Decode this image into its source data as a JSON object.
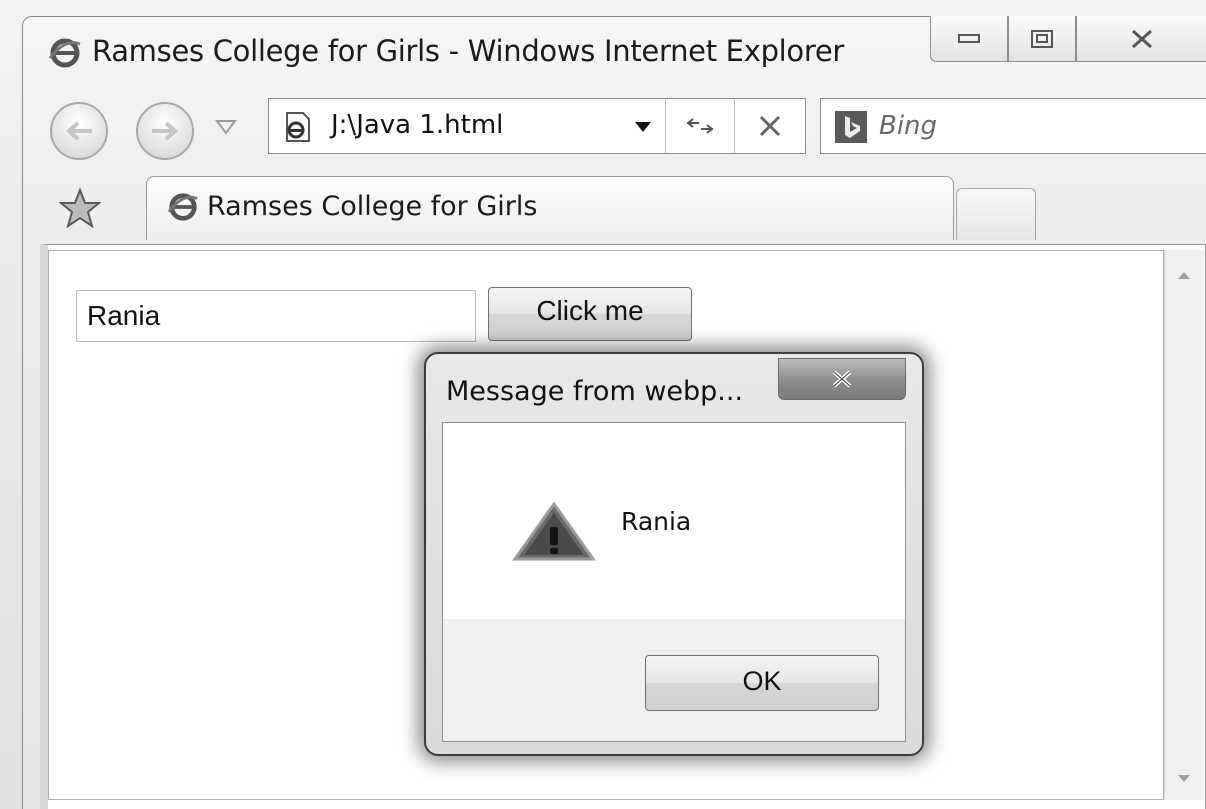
{
  "window": {
    "title": "Ramses College for Girls - Windows Internet Explorer"
  },
  "navigation": {
    "address": "J:\\Java 1.html",
    "search_placeholder": "Bing"
  },
  "tabs": [
    {
      "label": "Ramses College for Girls",
      "active": true
    }
  ],
  "page": {
    "input_value": "Rania",
    "button_label": "Click me"
  },
  "alert": {
    "title": "Message from webp...",
    "message": "Rania",
    "ok_label": "OK"
  },
  "icons": {
    "browser": "ie-logo-icon",
    "favorites": "star-icon",
    "search_provider": "bing-icon",
    "alert": "warning-icon"
  },
  "colors": {
    "chrome": "#e8e8e8",
    "border": "#8d8d8d",
    "dialog_shadow": "#3c3c3c"
  }
}
